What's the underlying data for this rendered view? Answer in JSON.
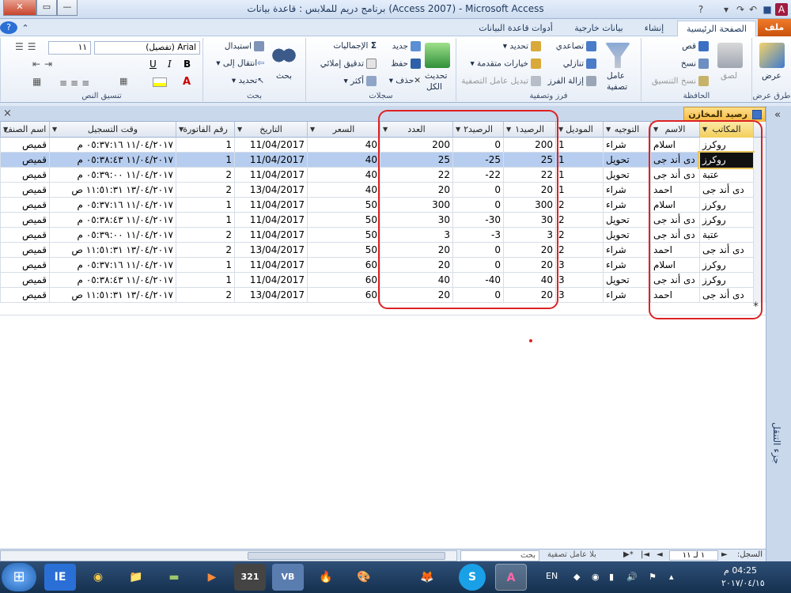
{
  "window": {
    "title": "برنامج دريم للملابس : قاعدة بيانات (Access 2007) - Microsoft Access",
    "close": "✕",
    "maximize": "▭",
    "minimize": "—"
  },
  "tabs": [
    {
      "label": "ملف"
    },
    {
      "label": "الصفحة الرئيسية"
    },
    {
      "label": "إنشاء"
    },
    {
      "label": "بيانات خارجية"
    },
    {
      "label": "أدوات قاعدة البيانات"
    }
  ],
  "ribbon": {
    "views": {
      "name": "طرق عرض",
      "view": "عرض"
    },
    "clipboard": {
      "name": "الحافظة",
      "paste": "لصق",
      "cut": "قص",
      "copy": "نسخ",
      "format_painter": "نسخ التنسيق"
    },
    "sort_filter": {
      "name": "فرز وتصفية",
      "filter": "عامل",
      "filter2": "تصفية",
      "ascending": "تصاعدي",
      "descending": "تنازلي",
      "remove_sort": "إزالة الفرز",
      "selection": "تحديد",
      "advanced": "خيارات متقدمة",
      "toggle_filter": "تبديل عامل التصفية"
    },
    "records": {
      "name": "سجلات",
      "refresh": "تحديث",
      "refresh2": "الكل",
      "new": "جديد",
      "save": "حفظ",
      "delete": "حذف",
      "totals": "الإجماليات",
      "spelling": "تدقيق إملائي",
      "more": "أكثر"
    },
    "find": {
      "name": "بحث",
      "find": "بحث",
      "replace": "استبدال",
      "goto": "انتقال إلى",
      "select": "تحديد"
    },
    "text_format": {
      "name": "تنسيق النص",
      "font": "Arial (تفصيل)",
      "size": "١١",
      "bold": "B",
      "italic": "I",
      "underline": "U"
    }
  },
  "document": {
    "tab_title": "رصيد المخازن",
    "close": "×"
  },
  "nav_pane": {
    "label": "جزء التنقل",
    "toggle": "«"
  },
  "table": {
    "columns": [
      "المكاتب",
      "الاسم",
      "التوجيه",
      "الموديل",
      "الرصيد١",
      "الرصيد٢",
      "العدد",
      "السعر",
      "التاريخ",
      "رقم الفاتورة",
      "وقت التسجيل",
      "اسم الصنف"
    ],
    "rows": [
      [
        "روكرز",
        "اسلام",
        "شراء",
        "1",
        "200",
        "0",
        "200",
        "40",
        "11/04/2017",
        "1",
        "١١/٠٤/٢٠١٧ ٠٥:٣٧:١٦ م",
        "قميص"
      ],
      [
        "روكرز",
        "دى أند جى",
        "تحويل",
        "1",
        "25",
        "-25",
        "25",
        "40",
        "11/04/2017",
        "1",
        "١١/٠٤/٢٠١٧ ٠٥:٣٨:٤٣ م",
        "قميص"
      ],
      [
        "عتبة",
        "دى أند جى",
        "تحويل",
        "1",
        "22",
        "-22",
        "22",
        "40",
        "11/04/2017",
        "2",
        "١١/٠٤/٢٠١٧ ٠٥:٣٩:٠٠ م",
        "قميص"
      ],
      [
        "دى أند جى",
        "احمد",
        "شراء",
        "1",
        "20",
        "0",
        "20",
        "40",
        "13/04/2017",
        "2",
        "١٣/٠٤/٢٠١٧ ١١:٥١:٣١ ص",
        "قميص"
      ],
      [
        "روكرز",
        "اسلام",
        "شراء",
        "2",
        "300",
        "0",
        "300",
        "50",
        "11/04/2017",
        "1",
        "١١/٠٤/٢٠١٧ ٠٥:٣٧:١٦ م",
        "قميص"
      ],
      [
        "روكرز",
        "دى أند جى",
        "تحويل",
        "2",
        "30",
        "-30",
        "30",
        "50",
        "11/04/2017",
        "1",
        "١١/٠٤/٢٠١٧ ٠٥:٣٨:٤٣ م",
        "قميص"
      ],
      [
        "عتبة",
        "دى أند جى",
        "تحويل",
        "2",
        "3",
        "-3",
        "3",
        "50",
        "11/04/2017",
        "2",
        "١١/٠٤/٢٠١٧ ٠٥:٣٩:٠٠ م",
        "قميص"
      ],
      [
        "دى أند جى",
        "احمد",
        "شراء",
        "2",
        "20",
        "0",
        "20",
        "50",
        "13/04/2017",
        "2",
        "١٣/٠٤/٢٠١٧ ١١:٥١:٣١ ص",
        "قميص"
      ],
      [
        "روكرز",
        "اسلام",
        "شراء",
        "3",
        "20",
        "0",
        "20",
        "60",
        "11/04/2017",
        "1",
        "١١/٠٤/٢٠١٧ ٠٥:٣٧:١٦ م",
        "قميص"
      ],
      [
        "روكرز",
        "دى أند جى",
        "تحويل",
        "3",
        "40",
        "-40",
        "40",
        "60",
        "11/04/2017",
        "1",
        "١١/٠٤/٢٠١٧ ٠٥:٣٨:٤٣ م",
        "قميص"
      ],
      [
        "دى أند جى",
        "احمد",
        "شراء",
        "3",
        "20",
        "0",
        "20",
        "60",
        "13/04/2017",
        "2",
        "١٣/٠٤/٢٠١٧ ١١:٥١:٣١ ص",
        "قميص"
      ]
    ],
    "new_row_marker": "*"
  },
  "statusbar": {
    "record_label": "السجل:",
    "record_pos": "١ لـ ١١",
    "filter": "بلا عامل تصفية",
    "search": "بحث",
    "first": "|◄",
    "prev": "◄",
    "next": "►",
    "last": "►|"
  },
  "taskbar": {
    "start": "⊞",
    "lang": "EN",
    "time": "04:25 م",
    "date": "٢٠١٧/٠٤/١٥",
    "apps": [
      "IE",
      "◉",
      "📁",
      "▬",
      "▶",
      "321",
      "VB",
      "🔥",
      "🎨",
      "🦊",
      "S",
      "A"
    ]
  },
  "colors": {
    "accent": "#f07b2a",
    "selection": "#b6cdef",
    "annotation": "#dd2222"
  }
}
